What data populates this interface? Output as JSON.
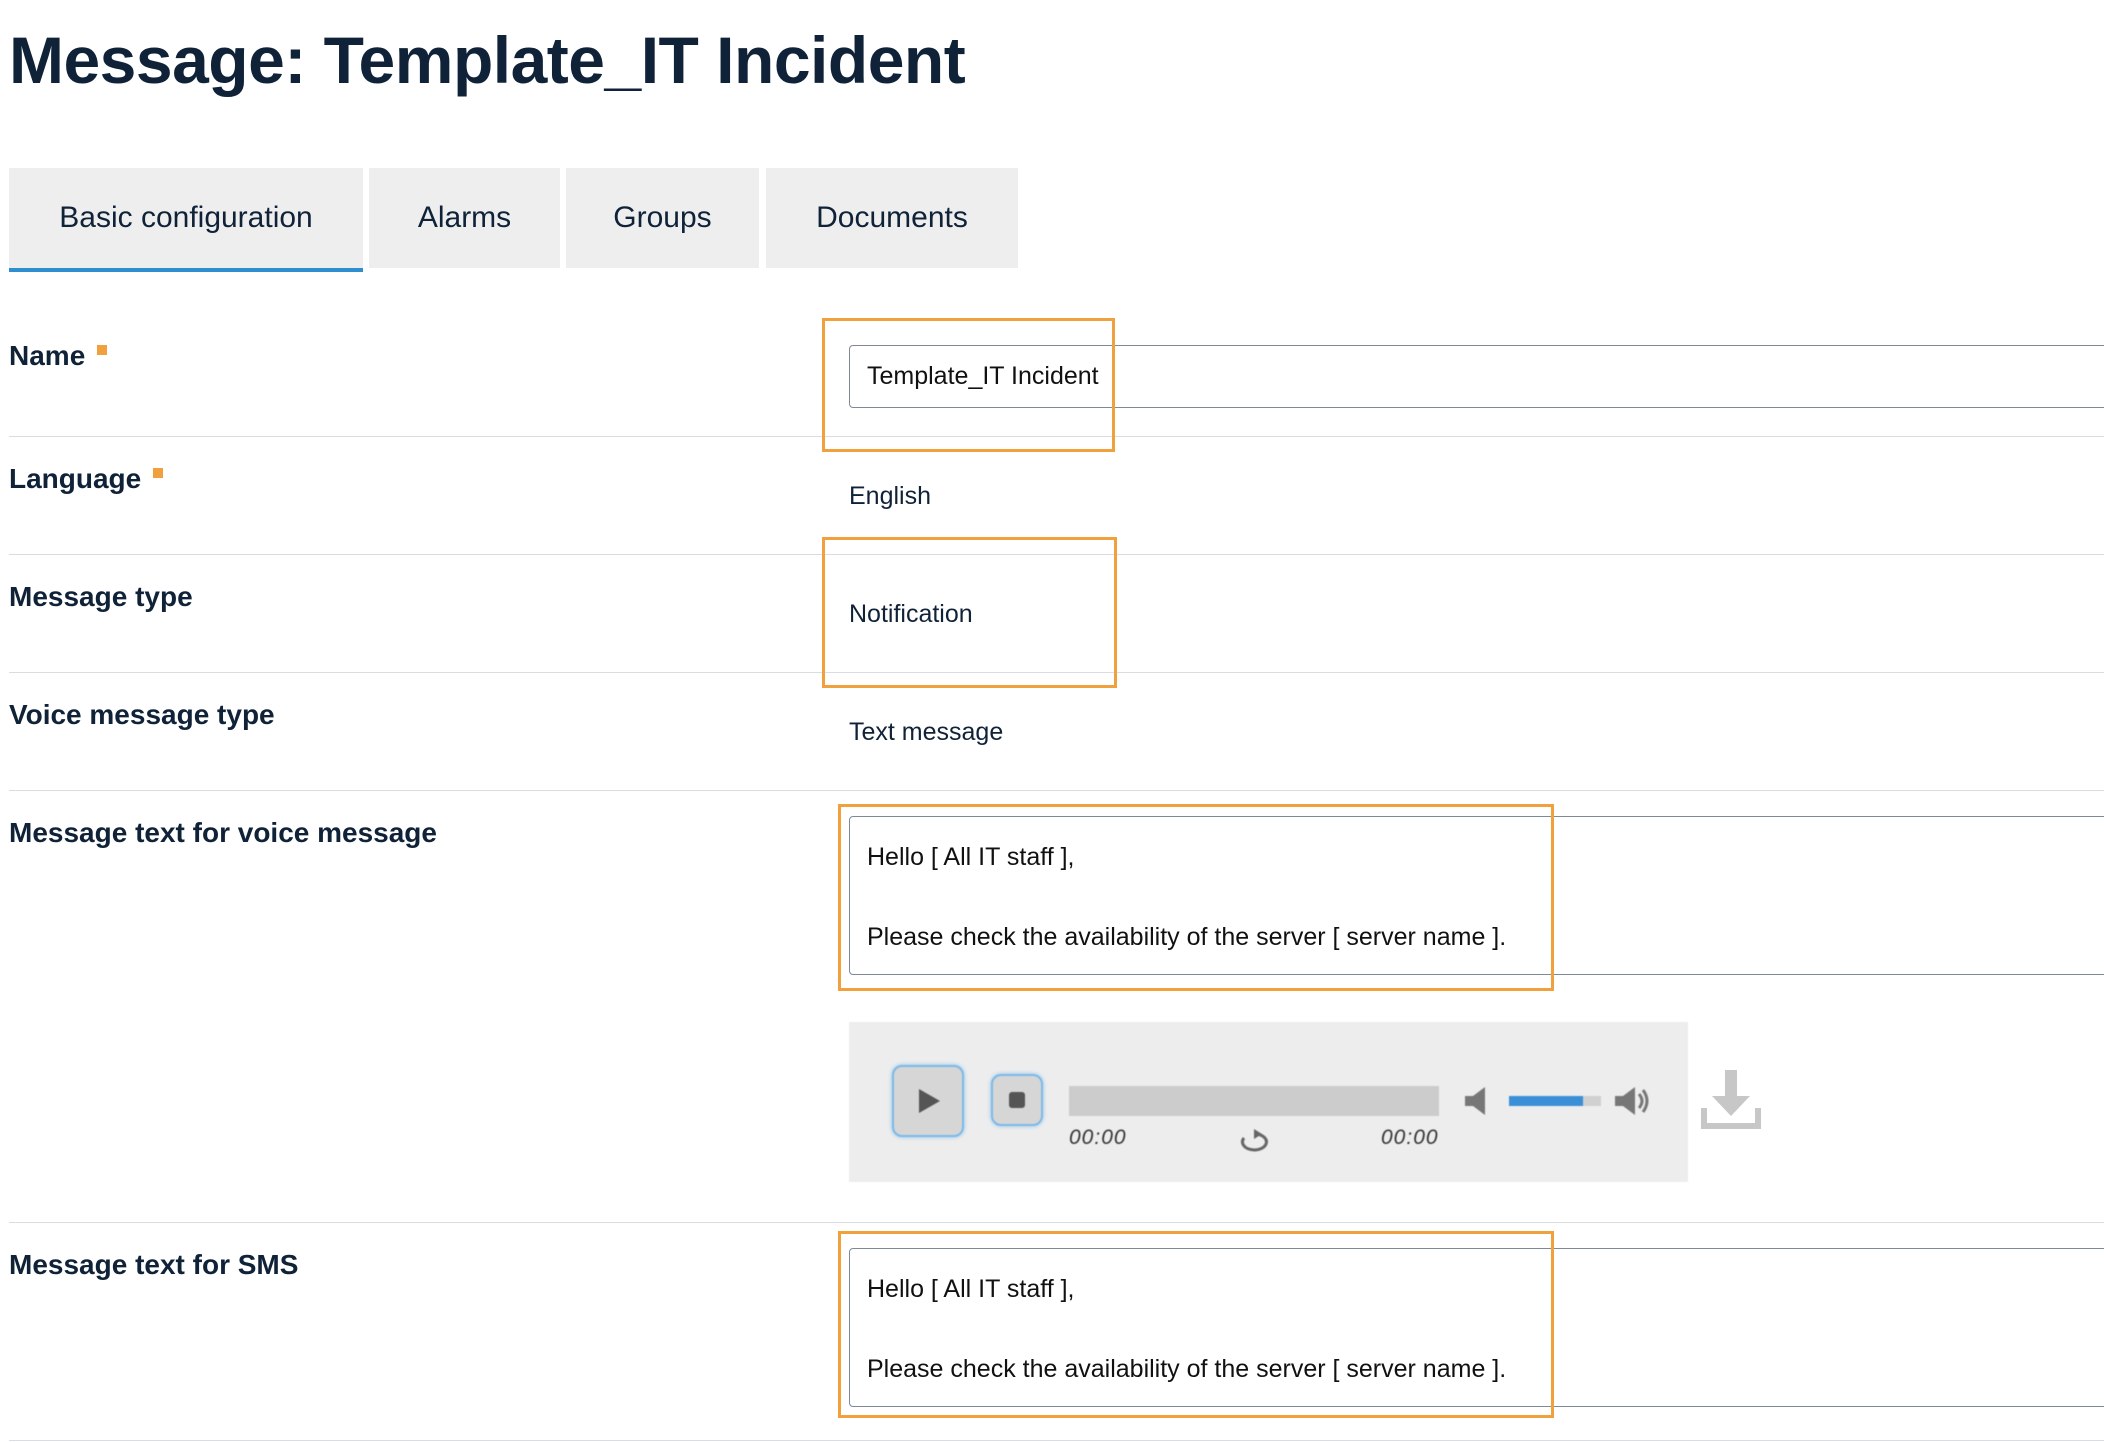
{
  "page": {
    "title": "Message: Template_IT Incident"
  },
  "tabs": [
    {
      "label": "Basic configuration",
      "active": true
    },
    {
      "label": "Alarms",
      "active": false
    },
    {
      "label": "Groups",
      "active": false
    },
    {
      "label": "Documents",
      "active": false
    }
  ],
  "form": {
    "name": {
      "label": "Name",
      "required": true,
      "value": "Template_IT Incident"
    },
    "language": {
      "label": "Language",
      "required": true,
      "value": "English"
    },
    "message_type": {
      "label": "Message type",
      "value": "Notification"
    },
    "voice_message_type": {
      "label": "Voice message type",
      "value": "Text message"
    },
    "voice_text": {
      "label": "Message text for voice message",
      "line1": "Hello [ All IT staff ],",
      "line2": "Please check the availability of the server [ server name ]."
    },
    "sms_text": {
      "label": "Message text for SMS",
      "line1": "Hello [ All IT staff ],",
      "line2": "Please check the availability of the server [ server name ]."
    }
  },
  "player": {
    "current_time": "00:00",
    "total_time": "00:00",
    "volume_level": 0.8,
    "icons": [
      "play-icon",
      "stop-icon",
      "loop-icon",
      "volume-mute-icon",
      "volume-max-icon",
      "download-icon"
    ]
  },
  "colors": {
    "highlight": "#f0a03c",
    "accent": "#2f8fce",
    "heading": "#0f2238",
    "tab_bg": "#eeeeee"
  }
}
